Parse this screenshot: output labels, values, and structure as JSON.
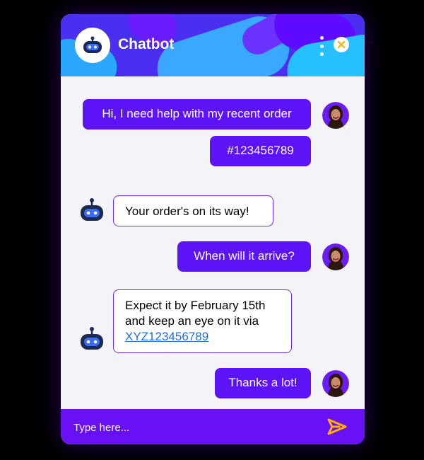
{
  "app": {
    "title": "Chatbot"
  },
  "messages": {
    "user_1a": "Hi, I need help with my recent order",
    "user_1b": "#123456789",
    "bot_1": "Your order's on its way!",
    "user_2": "When will it arrive?",
    "bot_2": {
      "line1": "Expect it by February 15th",
      "line2": "and keep an eye on it via",
      "link": "XYZ123456789"
    },
    "user_3": "Thanks a lot!"
  },
  "input": {
    "placeholder": "Type here..."
  },
  "icons": {
    "bot": "robot-icon",
    "menu": "more-vertical-icon",
    "close": "close-icon",
    "send": "send-icon",
    "user": "user-avatar"
  },
  "colors": {
    "accent": "#5c13f6",
    "input_bar": "#6a10f5",
    "close": "#ffb000",
    "send": "#ffb000",
    "link": "#1f6fe0"
  }
}
